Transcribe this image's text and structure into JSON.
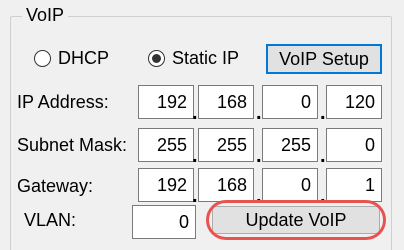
{
  "group": {
    "title": "VoIP"
  },
  "mode": {
    "dhcp_label": "DHCP",
    "static_label": "Static IP",
    "selected": "Static IP"
  },
  "buttons": {
    "setup_label": "VoIP Setup",
    "update_label": "Update VoIP"
  },
  "rows": {
    "ip": {
      "label": "IP Address:",
      "octets": [
        "192",
        "168",
        "0",
        "120"
      ]
    },
    "subnet": {
      "label": "Subnet Mask:",
      "octets": [
        "255",
        "255",
        "255",
        "0"
      ]
    },
    "gateway": {
      "label": "Gateway:",
      "octets": [
        "192",
        "168",
        "0",
        "1"
      ]
    }
  },
  "vlan": {
    "label": "VLAN:",
    "value": "0"
  },
  "colors": {
    "focus_border": "#0078d7",
    "highlight_ring": "#e8524f",
    "background": "#f0f0f0"
  }
}
